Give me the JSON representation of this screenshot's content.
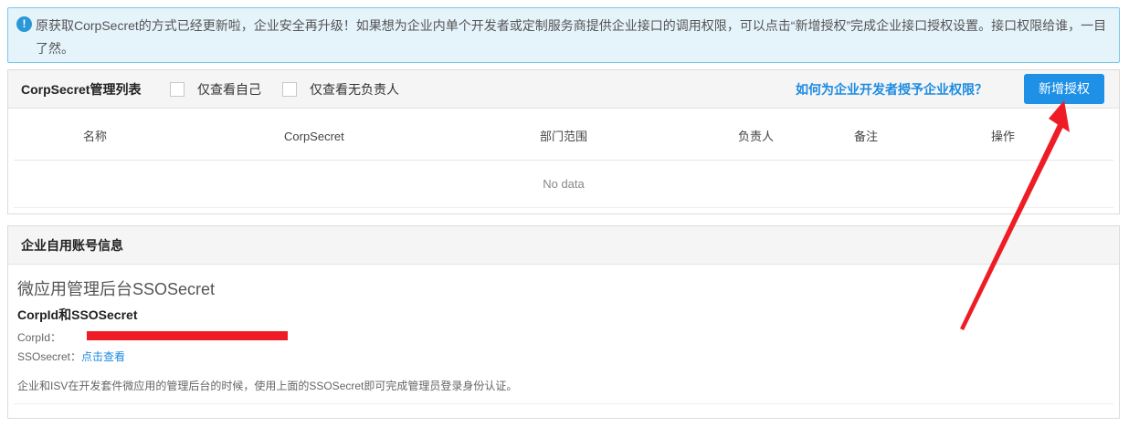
{
  "notice": {
    "icon": "info-icon",
    "text": "原获取CorpSecret的方式已经更新啦，企业安全再升级！如果想为企业内单个开发者或定制服务商提供企业接口的调用权限，可以点击“新增授权”完成企业接口授权设置。接口权限给谁，一目了然。"
  },
  "secret_panel": {
    "title": "CorpSecret管理列表",
    "filter_self_label": "仅查看自己",
    "filter_unowned_label": "仅查看无负责人",
    "help_link": "如何为企业开发者授予企业权限？",
    "add_button": "新增授权",
    "columns": [
      "名称",
      "CorpSecret",
      "部门范围",
      "负责人",
      "备注",
      "操作"
    ],
    "empty_text": "No data"
  },
  "account_panel": {
    "title": "企业自用账号信息",
    "sso_title": "微应用管理后台SSOSecret",
    "subtitle": "CorpId和SSOSecret",
    "corpid_label": "CorpId：",
    "ssosecret_label": "SSOsecret：",
    "view_link": "点击查看",
    "description": "企业和ISV在开发套件微应用的管理后台的时候，使用上面的SSOSecret即可完成管理员登录身份认证。"
  },
  "colors": {
    "accent": "#1e90e6",
    "link": "#1c8be0",
    "annotation_red": "#ee1c24",
    "notice_bg": "#e5f3fb"
  }
}
